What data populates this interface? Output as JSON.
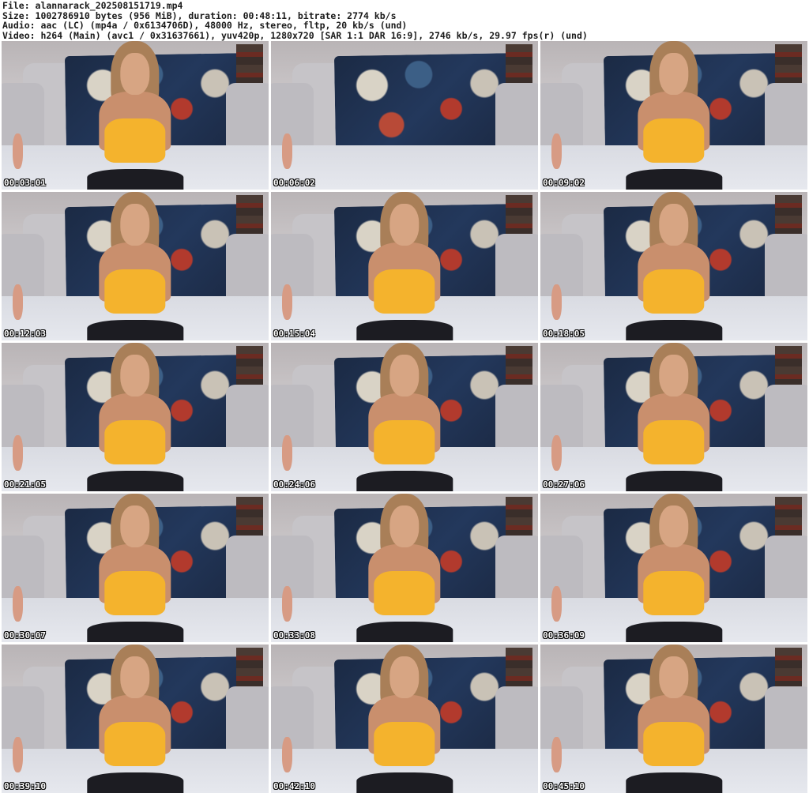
{
  "header": {
    "file": "File: alannarack_202508151719.mp4",
    "size": "Size: 1002786910 bytes (956 MiB), duration: 00:48:11, bitrate: 2774 kb/s",
    "audio": "Audio: aac (LC) (mp4a / 0x6134706D), 48000 Hz, stereo, fltp, 20 kb/s (und)",
    "video": "Video: h264 (Main) (avc1 / 0x31637661), yuv420p, 1280x720 [SAR 1:1 DAR 16:9], 2746 kb/s, 29.97 fps(r) (und)"
  },
  "thumbnails": [
    {
      "timestamp": "00:03:01",
      "person": true
    },
    {
      "timestamp": "00:06:02",
      "person": false
    },
    {
      "timestamp": "00:09:02",
      "person": true
    },
    {
      "timestamp": "00:12:03",
      "person": true
    },
    {
      "timestamp": "00:15:04",
      "person": true
    },
    {
      "timestamp": "00:18:05",
      "person": true
    },
    {
      "timestamp": "00:21:05",
      "person": true
    },
    {
      "timestamp": "00:24:06",
      "person": true
    },
    {
      "timestamp": "00:27:06",
      "person": true
    },
    {
      "timestamp": "00:30:07",
      "person": true
    },
    {
      "timestamp": "00:33:08",
      "person": true
    },
    {
      "timestamp": "00:36:09",
      "person": true
    },
    {
      "timestamp": "00:39:10",
      "person": true
    },
    {
      "timestamp": "00:42:10",
      "person": true
    },
    {
      "timestamp": "00:45:10",
      "person": true
    }
  ],
  "colors": {
    "top": "#f4b32d",
    "timestamp_text": "#ffffff"
  }
}
